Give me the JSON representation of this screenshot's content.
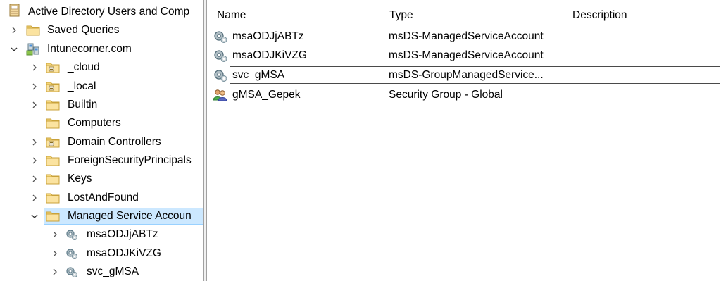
{
  "tree": {
    "root": {
      "label": "Active Directory Users and Comp",
      "icon": "console-root-icon"
    },
    "items": [
      {
        "label": "Saved Queries",
        "icon": "folder-icon",
        "chevron": "chevron-right-icon"
      },
      {
        "label": "Intunecorner.com",
        "icon": "domain-icon",
        "chevron": "chevron-down-icon"
      },
      {
        "label": "_cloud",
        "icon": "ou-folder-icon",
        "chevron": "chevron-right-icon"
      },
      {
        "label": "_local",
        "icon": "ou-folder-icon",
        "chevron": "chevron-right-icon"
      },
      {
        "label": "Builtin",
        "icon": "folder-icon",
        "chevron": "chevron-right-icon"
      },
      {
        "label": "Computers",
        "icon": "folder-icon",
        "chevron": ""
      },
      {
        "label": "Domain Controllers",
        "icon": "ou-folder-icon",
        "chevron": "chevron-right-icon"
      },
      {
        "label": "ForeignSecurityPrincipals",
        "icon": "folder-icon",
        "chevron": "chevron-right-icon"
      },
      {
        "label": "Keys",
        "icon": "folder-icon",
        "chevron": "chevron-right-icon"
      },
      {
        "label": "LostAndFound",
        "icon": "folder-icon",
        "chevron": "chevron-right-icon"
      },
      {
        "label": "Managed Service Accoun",
        "icon": "folder-icon",
        "chevron": "chevron-down-icon",
        "selected": true
      },
      {
        "label": "msaODJjABTz",
        "icon": "service-account-icon",
        "chevron": "chevron-right-icon"
      },
      {
        "label": "msaODJKiVZG",
        "icon": "service-account-icon",
        "chevron": "chevron-right-icon"
      },
      {
        "label": "svc_gMSA",
        "icon": "service-account-icon",
        "chevron": "chevron-right-icon"
      }
    ]
  },
  "list": {
    "columns": [
      "Name",
      "Type",
      "Description"
    ],
    "rows": [
      {
        "name": "msaODJjABTz",
        "type": "msDS-ManagedServiceAccount",
        "description": "",
        "icon": "service-account-icon"
      },
      {
        "name": "msaODJKiVZG",
        "type": "msDS-ManagedServiceAccount",
        "description": "",
        "icon": "service-account-icon"
      },
      {
        "name": "svc_gMSA",
        "type": "msDS-GroupManagedService...",
        "description": "",
        "icon": "service-account-icon",
        "focused": true
      },
      {
        "name": "gMSA_Gepek",
        "type": "Security Group - Global",
        "description": "",
        "icon": "security-group-icon"
      }
    ]
  },
  "colors": {
    "selection_bg": "#cce8ff",
    "selection_border": "#99d1ff",
    "folder": "#f5d77a",
    "splitter": "#f0f0f0"
  }
}
